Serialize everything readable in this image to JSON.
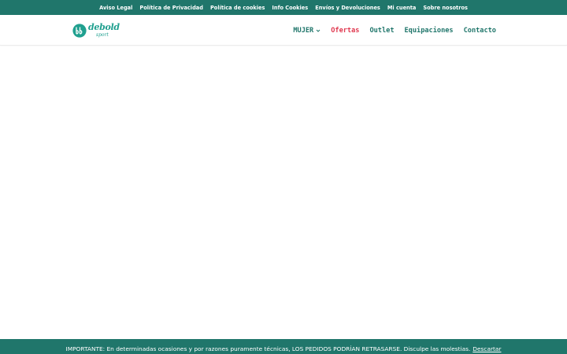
{
  "top_links": [
    "Aviso Legal",
    "Política de Privacidad",
    "Política de cookies",
    "Info Cookies",
    "Envíos y Devoluciones",
    "Mi cuenta",
    "Sobre nosotros"
  ],
  "logo": {
    "word": "debold",
    "sub": "sport"
  },
  "nav": {
    "mujer": "MUJER",
    "ofertas": "Ofertas",
    "outlet": "Outlet",
    "equipaciones": "Equipaciones",
    "contacto": "Contacto"
  },
  "notice": {
    "text": "IMPORTANTE: En determinadas ocasiones y por razones puramente técnicas, LOS PEDIDOS PODRÍAN RETRASARSE. Disculpe las molestias.",
    "dismiss": "Descartar"
  },
  "colors": {
    "brand": "#20766b",
    "logo": "#20a08f",
    "sale": "#e0384f"
  },
  "icons": {
    "logo_mark": "db-monogram-icon",
    "dropdown": "chevron-down-icon"
  }
}
